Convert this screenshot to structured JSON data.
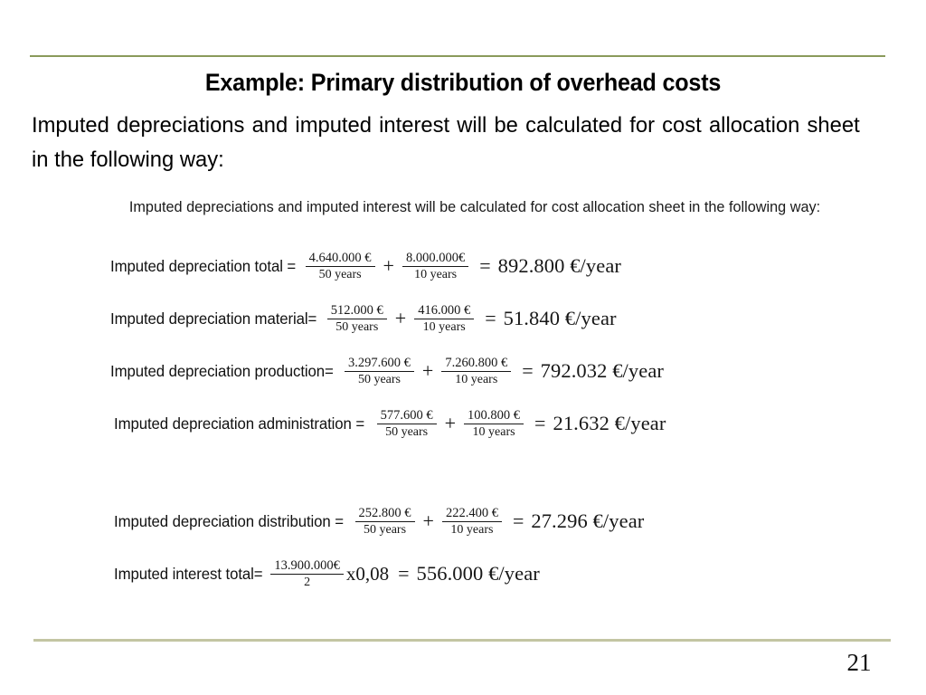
{
  "slide": {
    "title": "Example: Primary distribution of overhead costs",
    "intro": "Imputed depreciations and imputed interest will be calculated for cost allocation sheet in the following way:",
    "page_number": "21",
    "rule_color_top": "#8a9a5b",
    "rule_color_bottom": "#c3c5a3"
  },
  "figure": {
    "caption": "Imputed depreciations and imputed interest will be calculated for cost allocation sheet in the following way:",
    "equations": [
      {
        "label": "Imputed depreciation total =",
        "terms": [
          {
            "numerator": "4.640.000 €",
            "denominator": "50 years"
          },
          {
            "numerator": "8.000.000€",
            "denominator": "10 years"
          }
        ],
        "plus": "+",
        "equals": "=",
        "result": "892.800 €/year"
      },
      {
        "label": "Imputed depreciation material=",
        "terms": [
          {
            "numerator": "512.000 €",
            "denominator": "50 years"
          },
          {
            "numerator": "416.000 €",
            "denominator": "10 years"
          }
        ],
        "plus": "+",
        "equals": "=",
        "result": "51.840 €/year"
      },
      {
        "label": "Imputed depreciation production=",
        "terms": [
          {
            "numerator": "3.297.600 €",
            "denominator": "50 years"
          },
          {
            "numerator": "7.260.800 €",
            "denominator": "10 years"
          }
        ],
        "plus": "+",
        "equals": "=",
        "result": "792.032 €/year"
      },
      {
        "label": "Imputed depreciation administration =",
        "terms": [
          {
            "numerator": "577.600 €",
            "denominator": "50 years"
          },
          {
            "numerator": "100.800 €",
            "denominator": "10 years"
          }
        ],
        "plus": "+",
        "equals": "=",
        "result": "21.632 €/year"
      },
      {
        "label": "Imputed depreciation distribution =",
        "terms": [
          {
            "numerator": "252.800 €",
            "denominator": "50 years"
          },
          {
            "numerator": "222.400 €",
            "denominator": "10 years"
          }
        ],
        "plus": "+",
        "equals": "=",
        "result": "27.296 €/year"
      },
      {
        "label": "Imputed interest total=",
        "terms": [
          {
            "numerator": "13.900.000€",
            "denominator": "2"
          }
        ],
        "multiplier": "x0,08",
        "equals": "=",
        "result": "556.000 €/year"
      }
    ]
  }
}
